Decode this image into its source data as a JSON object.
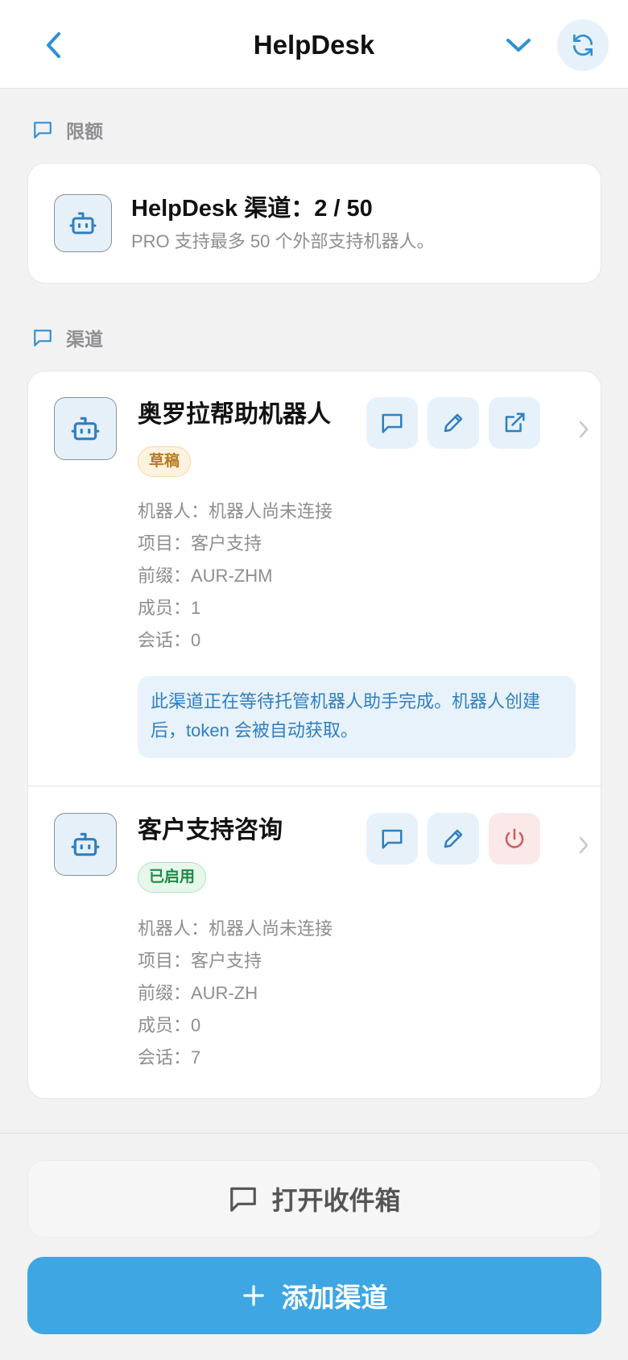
{
  "header": {
    "title": "HelpDesk"
  },
  "quota_section": {
    "label": "限额"
  },
  "quota_card": {
    "title": "HelpDesk 渠道：2 / 50",
    "subtitle": "PRO 支持最多 50 个外部支持机器人。"
  },
  "channels_section": {
    "label": "渠道"
  },
  "channels": [
    {
      "name": "奥罗拉帮助机器人",
      "status": "草稿",
      "bot": "机器人：机器人尚未连接",
      "project": "项目：客户支持",
      "prefix": "前缀：AUR-ZHM",
      "members": "成员：1",
      "conversations": "会话：0",
      "notice": "此渠道正在等待托管机器人助手完成。机器人创建后，token 会被自动获取。"
    },
    {
      "name": "客户支持咨询",
      "status": "已启用",
      "bot": "机器人：机器人尚未连接",
      "project": "项目：客户支持",
      "prefix": "前缀：AUR-ZH",
      "members": "成员：0",
      "conversations": "会话：7"
    }
  ],
  "actions": {
    "open_inbox": "打开收件箱",
    "add_channel": "添加渠道"
  },
  "colors": {
    "accent": "#3ea6e3",
    "icon_blue": "#2f7fc2",
    "draft": "#b7791f",
    "enabled": "#1e8a45",
    "danger": "#d05a5a"
  }
}
